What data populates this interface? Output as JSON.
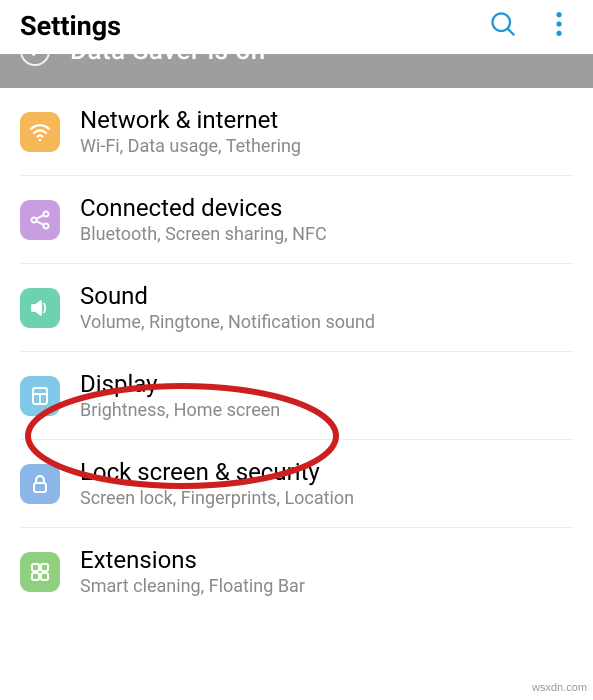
{
  "header": {
    "title": "Settings"
  },
  "banner": {
    "text_partial": "Data Saver is on"
  },
  "items": [
    {
      "title": "Network & internet",
      "subtitle": "Wi-Fi, Data usage, Tethering"
    },
    {
      "title": "Connected devices",
      "subtitle": "Bluetooth, Screen sharing, NFC"
    },
    {
      "title": "Sound",
      "subtitle": "Volume, Ringtone, Notification sound"
    },
    {
      "title": "Display",
      "subtitle": "Brightness, Home screen"
    },
    {
      "title": "Lock screen & security",
      "subtitle": "Screen lock, Fingerprints, Location"
    },
    {
      "title": "Extensions",
      "subtitle": "Smart cleaning, Floating Bar"
    }
  ],
  "watermark": "wsxdn.com"
}
